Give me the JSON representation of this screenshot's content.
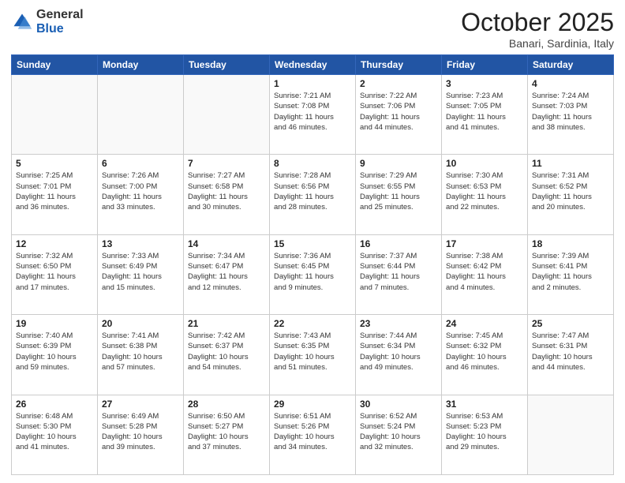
{
  "logo": {
    "general": "General",
    "blue": "Blue"
  },
  "title": {
    "month": "October 2025",
    "location": "Banari, Sardinia, Italy"
  },
  "weekdays": [
    "Sunday",
    "Monday",
    "Tuesday",
    "Wednesday",
    "Thursday",
    "Friday",
    "Saturday"
  ],
  "weeks": [
    {
      "days": [
        {
          "num": "",
          "info": ""
        },
        {
          "num": "",
          "info": ""
        },
        {
          "num": "",
          "info": ""
        },
        {
          "num": "1",
          "info": "Sunrise: 7:21 AM\nSunset: 7:08 PM\nDaylight: 11 hours\nand 46 minutes."
        },
        {
          "num": "2",
          "info": "Sunrise: 7:22 AM\nSunset: 7:06 PM\nDaylight: 11 hours\nand 44 minutes."
        },
        {
          "num": "3",
          "info": "Sunrise: 7:23 AM\nSunset: 7:05 PM\nDaylight: 11 hours\nand 41 minutes."
        },
        {
          "num": "4",
          "info": "Sunrise: 7:24 AM\nSunset: 7:03 PM\nDaylight: 11 hours\nand 38 minutes."
        }
      ]
    },
    {
      "days": [
        {
          "num": "5",
          "info": "Sunrise: 7:25 AM\nSunset: 7:01 PM\nDaylight: 11 hours\nand 36 minutes."
        },
        {
          "num": "6",
          "info": "Sunrise: 7:26 AM\nSunset: 7:00 PM\nDaylight: 11 hours\nand 33 minutes."
        },
        {
          "num": "7",
          "info": "Sunrise: 7:27 AM\nSunset: 6:58 PM\nDaylight: 11 hours\nand 30 minutes."
        },
        {
          "num": "8",
          "info": "Sunrise: 7:28 AM\nSunset: 6:56 PM\nDaylight: 11 hours\nand 28 minutes."
        },
        {
          "num": "9",
          "info": "Sunrise: 7:29 AM\nSunset: 6:55 PM\nDaylight: 11 hours\nand 25 minutes."
        },
        {
          "num": "10",
          "info": "Sunrise: 7:30 AM\nSunset: 6:53 PM\nDaylight: 11 hours\nand 22 minutes."
        },
        {
          "num": "11",
          "info": "Sunrise: 7:31 AM\nSunset: 6:52 PM\nDaylight: 11 hours\nand 20 minutes."
        }
      ]
    },
    {
      "days": [
        {
          "num": "12",
          "info": "Sunrise: 7:32 AM\nSunset: 6:50 PM\nDaylight: 11 hours\nand 17 minutes."
        },
        {
          "num": "13",
          "info": "Sunrise: 7:33 AM\nSunset: 6:49 PM\nDaylight: 11 hours\nand 15 minutes."
        },
        {
          "num": "14",
          "info": "Sunrise: 7:34 AM\nSunset: 6:47 PM\nDaylight: 11 hours\nand 12 minutes."
        },
        {
          "num": "15",
          "info": "Sunrise: 7:36 AM\nSunset: 6:45 PM\nDaylight: 11 hours\nand 9 minutes."
        },
        {
          "num": "16",
          "info": "Sunrise: 7:37 AM\nSunset: 6:44 PM\nDaylight: 11 hours\nand 7 minutes."
        },
        {
          "num": "17",
          "info": "Sunrise: 7:38 AM\nSunset: 6:42 PM\nDaylight: 11 hours\nand 4 minutes."
        },
        {
          "num": "18",
          "info": "Sunrise: 7:39 AM\nSunset: 6:41 PM\nDaylight: 11 hours\nand 2 minutes."
        }
      ]
    },
    {
      "days": [
        {
          "num": "19",
          "info": "Sunrise: 7:40 AM\nSunset: 6:39 PM\nDaylight: 10 hours\nand 59 minutes."
        },
        {
          "num": "20",
          "info": "Sunrise: 7:41 AM\nSunset: 6:38 PM\nDaylight: 10 hours\nand 57 minutes."
        },
        {
          "num": "21",
          "info": "Sunrise: 7:42 AM\nSunset: 6:37 PM\nDaylight: 10 hours\nand 54 minutes."
        },
        {
          "num": "22",
          "info": "Sunrise: 7:43 AM\nSunset: 6:35 PM\nDaylight: 10 hours\nand 51 minutes."
        },
        {
          "num": "23",
          "info": "Sunrise: 7:44 AM\nSunset: 6:34 PM\nDaylight: 10 hours\nand 49 minutes."
        },
        {
          "num": "24",
          "info": "Sunrise: 7:45 AM\nSunset: 6:32 PM\nDaylight: 10 hours\nand 46 minutes."
        },
        {
          "num": "25",
          "info": "Sunrise: 7:47 AM\nSunset: 6:31 PM\nDaylight: 10 hours\nand 44 minutes."
        }
      ]
    },
    {
      "days": [
        {
          "num": "26",
          "info": "Sunrise: 6:48 AM\nSunset: 5:30 PM\nDaylight: 10 hours\nand 41 minutes."
        },
        {
          "num": "27",
          "info": "Sunrise: 6:49 AM\nSunset: 5:28 PM\nDaylight: 10 hours\nand 39 minutes."
        },
        {
          "num": "28",
          "info": "Sunrise: 6:50 AM\nSunset: 5:27 PM\nDaylight: 10 hours\nand 37 minutes."
        },
        {
          "num": "29",
          "info": "Sunrise: 6:51 AM\nSunset: 5:26 PM\nDaylight: 10 hours\nand 34 minutes."
        },
        {
          "num": "30",
          "info": "Sunrise: 6:52 AM\nSunset: 5:24 PM\nDaylight: 10 hours\nand 32 minutes."
        },
        {
          "num": "31",
          "info": "Sunrise: 6:53 AM\nSunset: 5:23 PM\nDaylight: 10 hours\nand 29 minutes."
        },
        {
          "num": "",
          "info": ""
        }
      ]
    }
  ]
}
